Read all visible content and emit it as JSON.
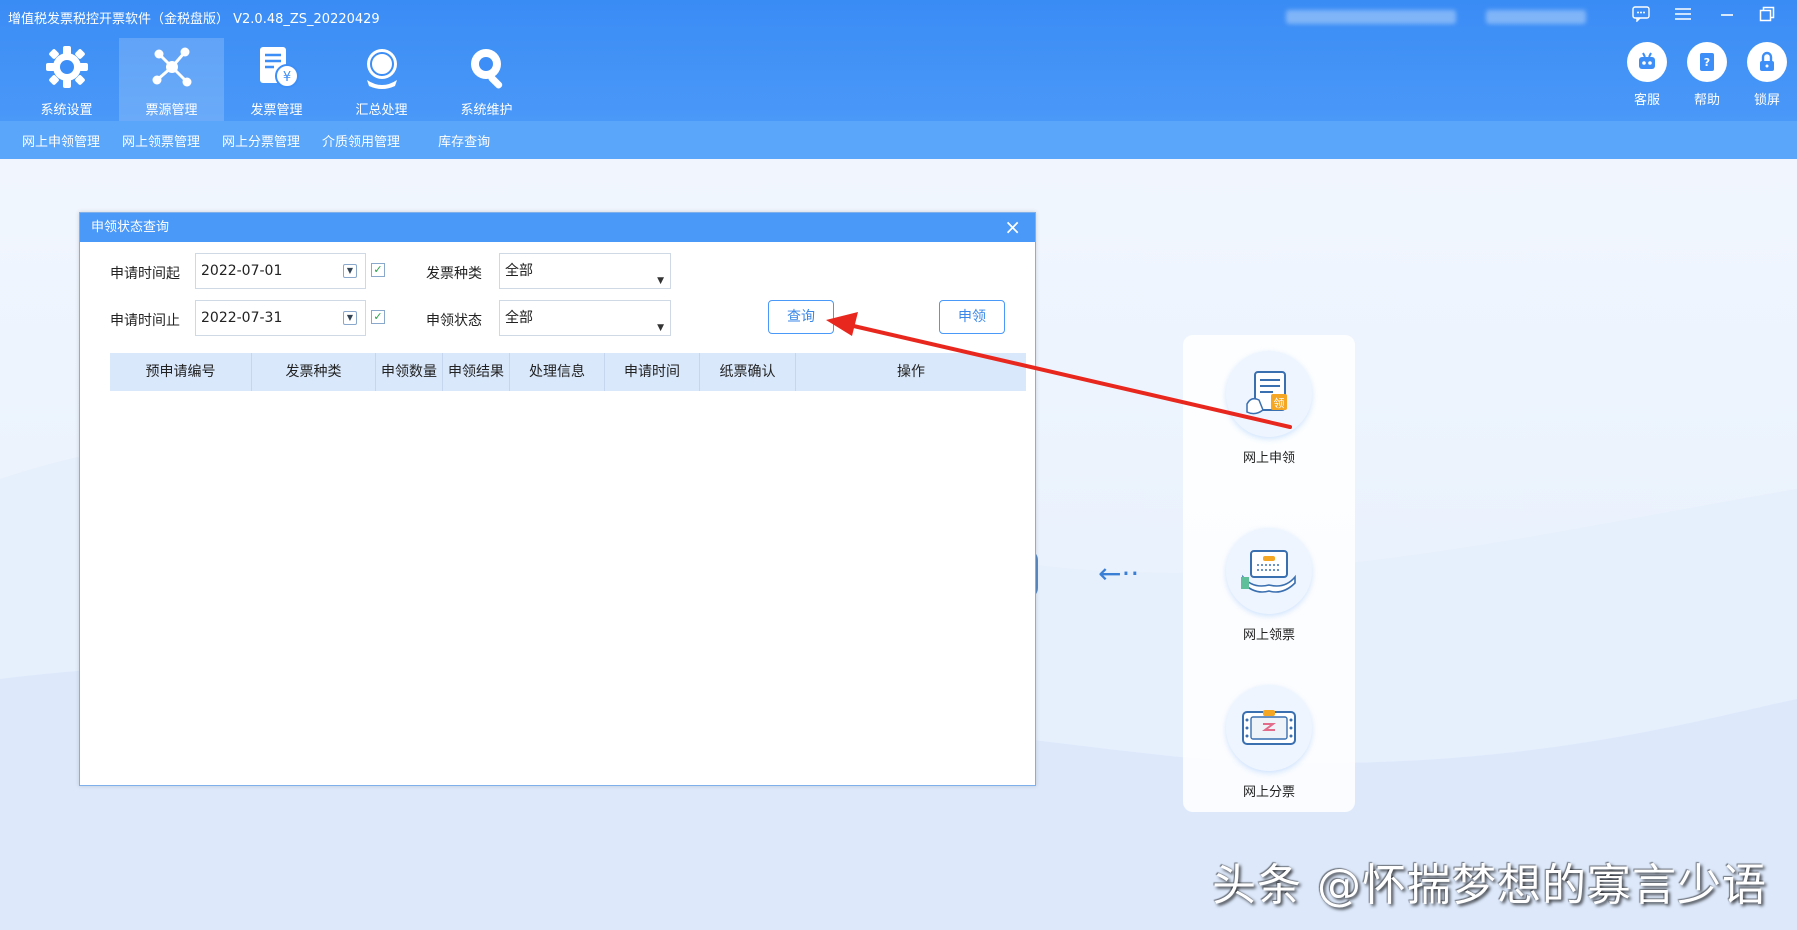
{
  "app": {
    "title": "增值税发票税控开票软件（金税盘版） V2.0.48_ZS_20220429"
  },
  "window_controls": [
    "message-icon",
    "menu-icon",
    "minimize-icon",
    "restore-icon"
  ],
  "nav": {
    "tabs": [
      {
        "label": "系统设置",
        "icon": "gear-icon"
      },
      {
        "label": "票源管理",
        "icon": "network-icon",
        "active": true
      },
      {
        "label": "发票管理",
        "icon": "invoice-yen-icon"
      },
      {
        "label": "汇总处理",
        "icon": "tax-summary-icon"
      },
      {
        "label": "系统维护",
        "icon": "wrench-gear-icon"
      }
    ]
  },
  "tools": [
    {
      "label": "客服",
      "icon": "robot-icon"
    },
    {
      "label": "帮助",
      "icon": "help-icon"
    },
    {
      "label": "锁屏",
      "icon": "lock-icon"
    }
  ],
  "subnav": [
    "网上申领管理",
    "网上领票管理",
    "网上分票管理",
    "介质领用管理",
    "库存查询"
  ],
  "dialog": {
    "title": "申领状态查询",
    "start_label": "申请时间起",
    "start_value": "2022-07-01",
    "end_label": "申请时间止",
    "end_value": "2022-07-31",
    "invoice_type_label": "发票种类",
    "invoice_type_value": "全部",
    "status_label": "申领状态",
    "status_value": "全部",
    "query_button": "查询",
    "apply_button": "申领",
    "columns": [
      "预申请编号",
      "发票种类",
      "申领数量",
      "申领结果",
      "处理信息",
      "申请时间",
      "纸票确认",
      "操作"
    ]
  },
  "right_panel": {
    "items": [
      {
        "label": "网上申领",
        "icon": "apply-document-icon",
        "badge": "领"
      },
      {
        "label": "网上领票",
        "icon": "receive-ticket-icon"
      },
      {
        "label": "网上分票",
        "icon": "split-ticket-icon"
      }
    ]
  },
  "watermark": "头条 @怀揣梦想的寡言少语",
  "colors": {
    "primary": "#4a98f8",
    "subnav": "#5aa6fb",
    "annotation_arrow": "#e8281e"
  }
}
